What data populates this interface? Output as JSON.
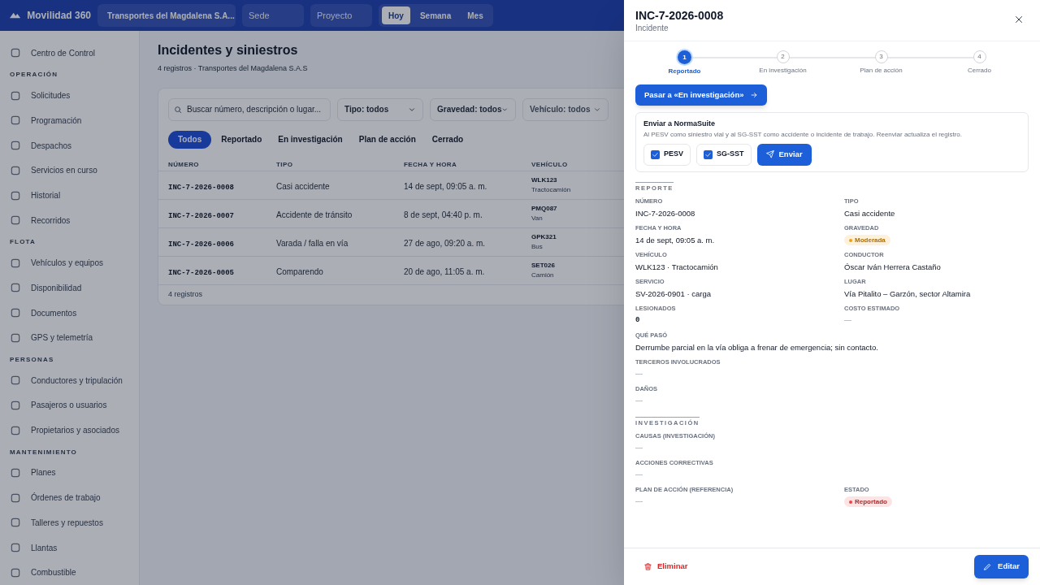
{
  "top_bar": {
    "app_name": "Movilidad 360",
    "company": "Transportes del Magdalena S.A...",
    "sede_placeholder": "Sede",
    "project_placeholder": "Proyecto",
    "ranges": [
      {
        "label": "Hoy",
        "selected": true
      },
      {
        "label": "Semana",
        "selected": false
      },
      {
        "label": "Mes",
        "selected": false
      }
    ]
  },
  "sidebar": {
    "top_item": "Centro de Control",
    "sections": [
      {
        "title": "OPERACIÓN",
        "items": [
          "Solicitudes",
          "Programación",
          "Despachos",
          "Servicios en curso",
          "Historial",
          "Recorridos"
        ]
      },
      {
        "title": "FLOTA",
        "items": [
          "Vehículos y equipos",
          "Disponibilidad",
          "Documentos",
          "GPS y telemetría"
        ]
      },
      {
        "title": "PERSONAS",
        "items": [
          "Conductores y tripulación",
          "Pasajeros o usuarios",
          "Propietarios y asociados"
        ]
      },
      {
        "title": "MANTENIMIENTO",
        "items": [
          "Planes",
          "Órdenes de trabajo",
          "Talleres y repuestos",
          "Llantas",
          "Combustible"
        ]
      }
    ]
  },
  "page": {
    "title": "Incidentes y siniestros",
    "subtitle": "4 registros · Transportes del Magdalena S.A.S",
    "search_placeholder": "Buscar número, descripción o lugar...",
    "filters": [
      "Tipo: todos",
      "Gravedad: todos",
      "Vehículo: todos"
    ],
    "status_tabs": [
      {
        "label": "Todos",
        "selected": true
      },
      {
        "label": "Reportado",
        "selected": false
      },
      {
        "label": "En investigación",
        "selected": false
      },
      {
        "label": "Plan de acción",
        "selected": false
      },
      {
        "label": "Cerrado",
        "selected": false
      }
    ],
    "table": {
      "columns": [
        "NÚMERO",
        "TIPO",
        "FECHA Y HORA",
        "VEHÍCULO"
      ],
      "rows": [
        {
          "number": "INC-7-2026-0008",
          "type": "Casi accidente",
          "date": "14 de sept, 09:05 a. m.",
          "vehicle": "WLK123",
          "vehicle_kind": "Tractocamión"
        },
        {
          "number": "INC-7-2026-0007",
          "type": "Accidente de tránsito",
          "date": "8 de sept, 04:40 p. m.",
          "vehicle": "PMQ087",
          "vehicle_kind": "Van"
        },
        {
          "number": "INC-7-2026-0006",
          "type": "Varada / falla en vía",
          "date": "27 de ago, 09:20 a. m.",
          "vehicle": "GPK321",
          "vehicle_kind": "Bus"
        },
        {
          "number": "INC-7-2026-0005",
          "type": "Comparendo",
          "date": "20 de ago, 11:05 a. m.",
          "vehicle": "SET026",
          "vehicle_kind": "Camión"
        }
      ]
    },
    "count": "4 registros"
  },
  "drawer": {
    "title": "INC-7-2026-0008",
    "subtitle": "Incidente",
    "steps": [
      {
        "number": "1",
        "label": "Reportado",
        "selected": true
      },
      {
        "number": "2",
        "label": "En investigación",
        "selected": false
      },
      {
        "number": "3",
        "label": "Plan de acción",
        "selected": false
      },
      {
        "number": "4",
        "label": "Cerrado",
        "selected": false
      }
    ],
    "advance_button": "Pasar a «En investigación»",
    "normasuite": {
      "title": "Enviar a NormaSuite",
      "description": "Al PESV como siniestro vial y al SG-SST como accidente o incidente de trabajo. Reenviar actualiza el registro.",
      "options": [
        {
          "label": "PESV",
          "checked": true
        },
        {
          "label": "SG-SST",
          "checked": true
        }
      ],
      "send_button": "Enviar"
    },
    "sections": [
      {
        "title": "REPORTE",
        "rows": [
          [
            {
              "label": "NÚMERO",
              "value": "INC-7-2026-0008",
              "kind": "text"
            },
            {
              "label": "TIPO",
              "value": "Casi accidente",
              "kind": "text"
            }
          ],
          [
            {
              "label": "FECHA Y HORA",
              "value": "14 de sept, 09:05 a. m.",
              "kind": "text"
            },
            {
              "label": "GRAVEDAD",
              "value": "Moderada",
              "kind": "badge",
              "color": "#f59e0b"
            }
          ],
          [
            {
              "label": "VEHÍCULO",
              "value": "WLK123 · Tractocamión",
              "kind": "text"
            },
            {
              "label": "CONDUCTOR",
              "value": "Óscar Iván Herrera Castaño",
              "kind": "text"
            }
          ],
          [
            {
              "label": "SERVICIO",
              "value": "SV-2026-0901 · carga",
              "kind": "text"
            },
            {
              "label": "LUGAR",
              "value": "Vía Pitalito – Garzón, sector Altamira",
              "kind": "text"
            }
          ],
          [
            {
              "label": "LESIONADOS",
              "value": "0",
              "kind": "mono"
            },
            {
              "label": "COSTO ESTIMADO",
              "value": "—",
              "kind": "empty"
            }
          ],
          [
            {
              "label": "QUÉ PASÓ",
              "value": "Derrumbe parcial en la vía obliga a frenar de emergencia; sin contacto.",
              "kind": "text"
            }
          ],
          [
            {
              "label": "TERCEROS INVOLUCRADOS",
              "value": "—",
              "kind": "empty"
            }
          ],
          [
            {
              "label": "DAÑOS",
              "value": "—",
              "kind": "empty"
            }
          ]
        ]
      },
      {
        "title": "INVESTIGACIÓN",
        "rows": [
          [
            {
              "label": "CAUSAS (INVESTIGACIÓN)",
              "value": "—",
              "kind": "empty"
            }
          ],
          [
            {
              "label": "ACCIONES CORRECTIVAS",
              "value": "—",
              "kind": "empty"
            }
          ],
          [
            {
              "label": "PLAN DE ACCIÓN (REFERENCIA)",
              "value": "—",
              "kind": "empty"
            },
            {
              "label": "ESTADO",
              "value": "Reportado",
              "kind": "badge",
              "color": "#ef4444"
            }
          ]
        ]
      }
    ],
    "delete_button": "Eliminar",
    "edit_button": "Editar"
  }
}
